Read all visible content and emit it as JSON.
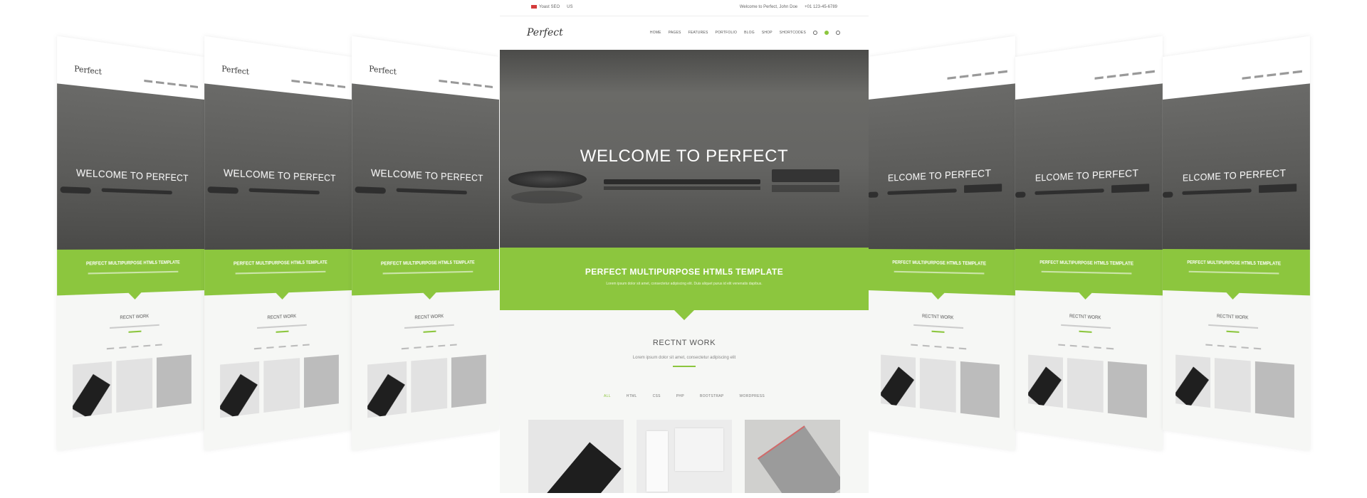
{
  "main": {
    "topbar": {
      "left": "Yoast SEO",
      "lang": "US",
      "right1": "Welcome to Perfect, John Doe",
      "right2": "+01 123-45-6789"
    },
    "logo": "Perfect",
    "nav": [
      "HOME",
      "PAGES",
      "FEATURES",
      "PORTFOLIO",
      "BLOG",
      "SHOP",
      "SHORTCODES"
    ],
    "hero_title": "WELCOME TO PERFECT",
    "banner_title": "PERFECT MULTIPURPOSE HTML5 TEMPLATE",
    "banner_sub": "Lorem ipsum dolor sit amet, consectetur adipiscing elit. Duis aliquet purus id elit venenatis dapibus.",
    "recent_title": "RECTNT WORK",
    "recent_sub": "Lorem ipsum dolor sit amet, consectetur adipiscing elit",
    "filters": [
      "ALL",
      "HTML",
      "CSS",
      "PHP",
      "BOOTSTRAP",
      "WORDPRESS"
    ]
  },
  "thumbs": {
    "logo": "Perfect",
    "hero_left": "WELCOME TO PERFECT",
    "hero_right": "ELCOME TO PERFECT",
    "banner_left": "PERFECT MULTIPURPOSE HTML5 TEMPLATE",
    "banner_right": "PERFECT MULTIPURPOSE HTML5 TEMPLATE",
    "recent_left": "RECNT WORK",
    "recent_right": "RECTNT WORK"
  },
  "colors": {
    "accent": "#8cc63e",
    "hero": "#5e5e5c",
    "background": "#f6f7f5"
  }
}
